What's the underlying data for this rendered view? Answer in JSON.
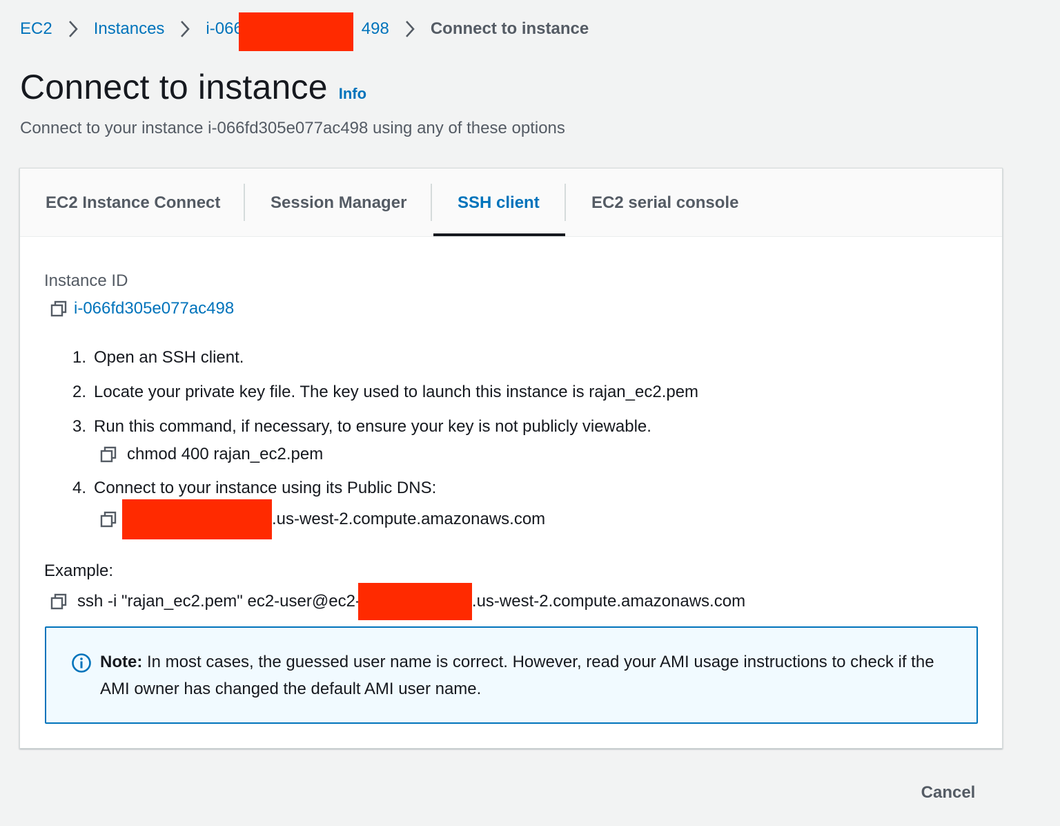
{
  "breadcrumb": {
    "items": [
      {
        "label": "EC2"
      },
      {
        "label": "Instances"
      },
      {
        "label_start": "i-066",
        "label_end": "498"
      },
      {
        "label": "Connect to instance"
      }
    ]
  },
  "header": {
    "title": "Connect to instance",
    "info": "Info",
    "description": "Connect to your instance i-066fd305e077ac498 using any of these options"
  },
  "tabs": [
    {
      "label": "EC2 Instance Connect",
      "active": false
    },
    {
      "label": "Session Manager",
      "active": false
    },
    {
      "label": "SSH client",
      "active": true
    },
    {
      "label": "EC2 serial console",
      "active": false
    }
  ],
  "ssh": {
    "instance_id_label": "Instance ID",
    "instance_id": "i-066fd305e077ac498",
    "steps": [
      {
        "num": "1.",
        "text": "Open an SSH client."
      },
      {
        "num": "2.",
        "text": "Locate your private key file. The key used to launch this instance is rajan_ec2.pem"
      },
      {
        "num": "3.",
        "text": "Run this command, if necessary, to ensure your key is not publicly viewable."
      },
      {
        "num": "4.",
        "text": "Connect to your instance using its Public DNS:"
      }
    ],
    "chmod_command": "chmod 400 rajan_ec2.pem",
    "public_dns_suffix": ".us-west-2.compute.amazonaws.com",
    "example_label": "Example:",
    "example_prefix": "ssh -i \"rajan_ec2.pem\" ec2-user@ec2-",
    "example_suffix": ".us-west-2.compute.amazonaws.com"
  },
  "note": {
    "bold": "Note:",
    "text": " In most cases, the guessed user name is correct. However, read your AMI usage instructions to check if the AMI owner has changed the default AMI user name."
  },
  "footer": {
    "cancel": "Cancel"
  },
  "colors": {
    "link": "#0073bb",
    "redaction": "#ff2a00",
    "note_background": "#f1faff"
  },
  "icons": {
    "breadcrumb_separator": "chevron-right-icon",
    "copy": "copy-icon",
    "note": "info-circle-icon"
  }
}
